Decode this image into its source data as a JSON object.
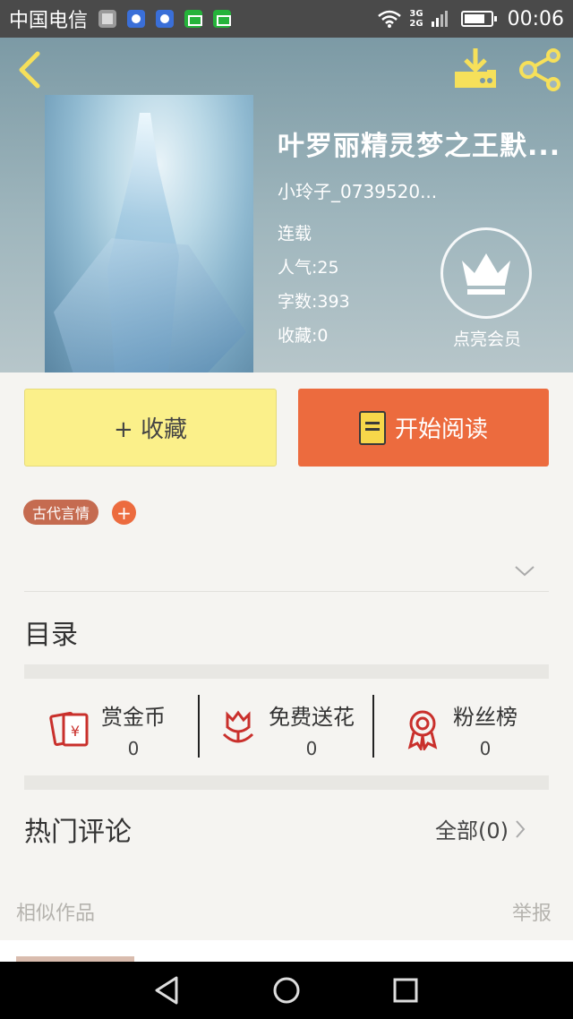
{
  "status_bar": {
    "carrier": "中国电信",
    "network": [
      "3G",
      "2G"
    ],
    "time": "00:06"
  },
  "book": {
    "title": "叶罗丽精灵梦之王默...",
    "author": "小玲子_0739520...",
    "status": "连载",
    "popularity_label": "人气:",
    "popularity": "25",
    "word_count_label": "字数:",
    "word_count": "393",
    "favorites_label": "收藏:",
    "favorites": "0"
  },
  "vip": {
    "label": "点亮会员"
  },
  "actions": {
    "collect_label": "+ 收藏",
    "read_label": "开始阅读"
  },
  "tags": {
    "items": [
      "古代言情"
    ],
    "add": "+"
  },
  "toc": {
    "title": "目录"
  },
  "stats": [
    {
      "label": "赏金币",
      "value": "0",
      "icon": "red-envelope-icon"
    },
    {
      "label": "免费送花",
      "value": "0",
      "icon": "flower-icon"
    },
    {
      "label": "粉丝榜",
      "value": "0",
      "icon": "award-icon"
    }
  ],
  "comments": {
    "title": "热门评论",
    "all_label": "全部(0)"
  },
  "similar": {
    "title": "相似作品",
    "report": "举报"
  },
  "colors": {
    "accent": "#ec6b3e",
    "collect_bg": "#fbf08a",
    "tag_bg": "#c56b50",
    "icon_red": "#c9302c"
  }
}
